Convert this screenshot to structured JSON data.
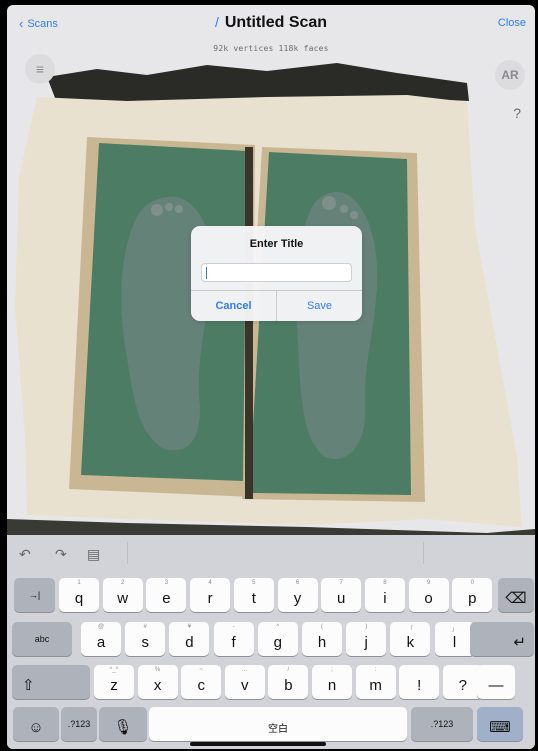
{
  "nav": {
    "back_label": "Scans",
    "title": "Untitled Scan",
    "close_label": "Close",
    "stats": "92k vertices  118k faces",
    "ar_label": "AR",
    "help_glyph": "?"
  },
  "dialog": {
    "title": "Enter Title",
    "input_value": "",
    "cancel_label": "Cancel",
    "save_label": "Save"
  },
  "keyboard": {
    "row1": [
      {
        "main": "q",
        "sub": "1"
      },
      {
        "main": "w",
        "sub": "2"
      },
      {
        "main": "e",
        "sub": "3"
      },
      {
        "main": "r",
        "sub": "4"
      },
      {
        "main": "t",
        "sub": "5"
      },
      {
        "main": "y",
        "sub": "6"
      },
      {
        "main": "u",
        "sub": "7"
      },
      {
        "main": "i",
        "sub": "8"
      },
      {
        "main": "o",
        "sub": "9"
      },
      {
        "main": "p",
        "sub": "0"
      }
    ],
    "row2": [
      {
        "main": "a",
        "sub": "@"
      },
      {
        "main": "s",
        "sub": "#"
      },
      {
        "main": "d",
        "sub": "¥"
      },
      {
        "main": "f",
        "sub": "-"
      },
      {
        "main": "g",
        "sub": "^"
      },
      {
        "main": "h",
        "sub": "("
      },
      {
        "main": "j",
        "sub": ")"
      },
      {
        "main": "k",
        "sub": "「"
      },
      {
        "main": "l",
        "sub": "」"
      }
    ],
    "row3": [
      {
        "main": "z",
        "sub": "^_^"
      },
      {
        "main": "x",
        "sub": "%"
      },
      {
        "main": "c",
        "sub": "~"
      },
      {
        "main": "v",
        "sub": "…"
      },
      {
        "main": "b",
        "sub": "/"
      },
      {
        "main": "n",
        "sub": ";"
      },
      {
        "main": "m",
        "sub": ":"
      },
      {
        "main": "!",
        "sub": ""
      },
      {
        "main": "?",
        "sub": ""
      }
    ],
    "row3_extra": "—",
    "tab_label": "→|",
    "delete_label": "⌫",
    "abc_label": "abc",
    "return_label": "↵",
    "shift_label": "⇧",
    "emoji_label": "☺",
    "num_label": ".?123",
    "mic_label": "🎙",
    "space_label": "空白",
    "num_label_right": ".?123",
    "hide_label": "⌨"
  }
}
